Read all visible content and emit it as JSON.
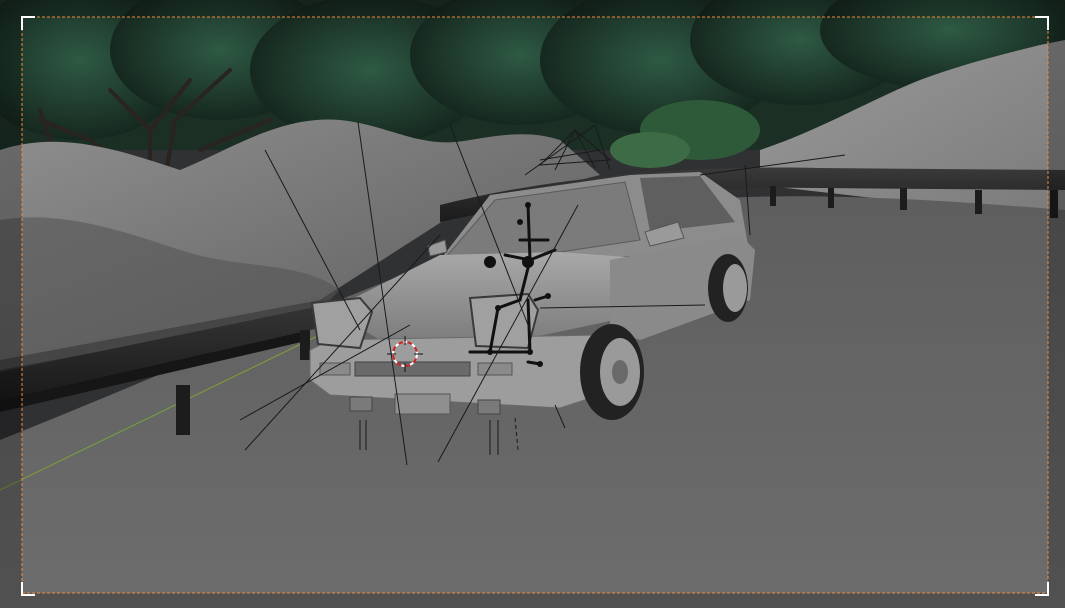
{
  "viewport": {
    "mode": "camera-view",
    "shading": "solid",
    "camera_frame_color": "#f08a3c",
    "cursor_3d_color": "#cc2222"
  },
  "scene": {
    "sky_color": "#2e3033",
    "foliage_color": "#1e3a2c",
    "ground_color": "#6b6b6b",
    "snow_color": "#8a8a8a",
    "guardrail_color": "#262626",
    "car_body_color": "#9a9a9a",
    "armature_color": "#111111",
    "grid_axis_color": "#7aa23a"
  },
  "objects": [
    {
      "name": "car",
      "icon": "car-icon"
    },
    {
      "name": "guardrail",
      "icon": "guardrail-icon"
    },
    {
      "name": "armature",
      "icon": "bone-icon"
    },
    {
      "name": "light-cone",
      "icon": "spotlight-icon"
    },
    {
      "name": "3d-cursor",
      "icon": "cursor-3d-icon"
    }
  ]
}
